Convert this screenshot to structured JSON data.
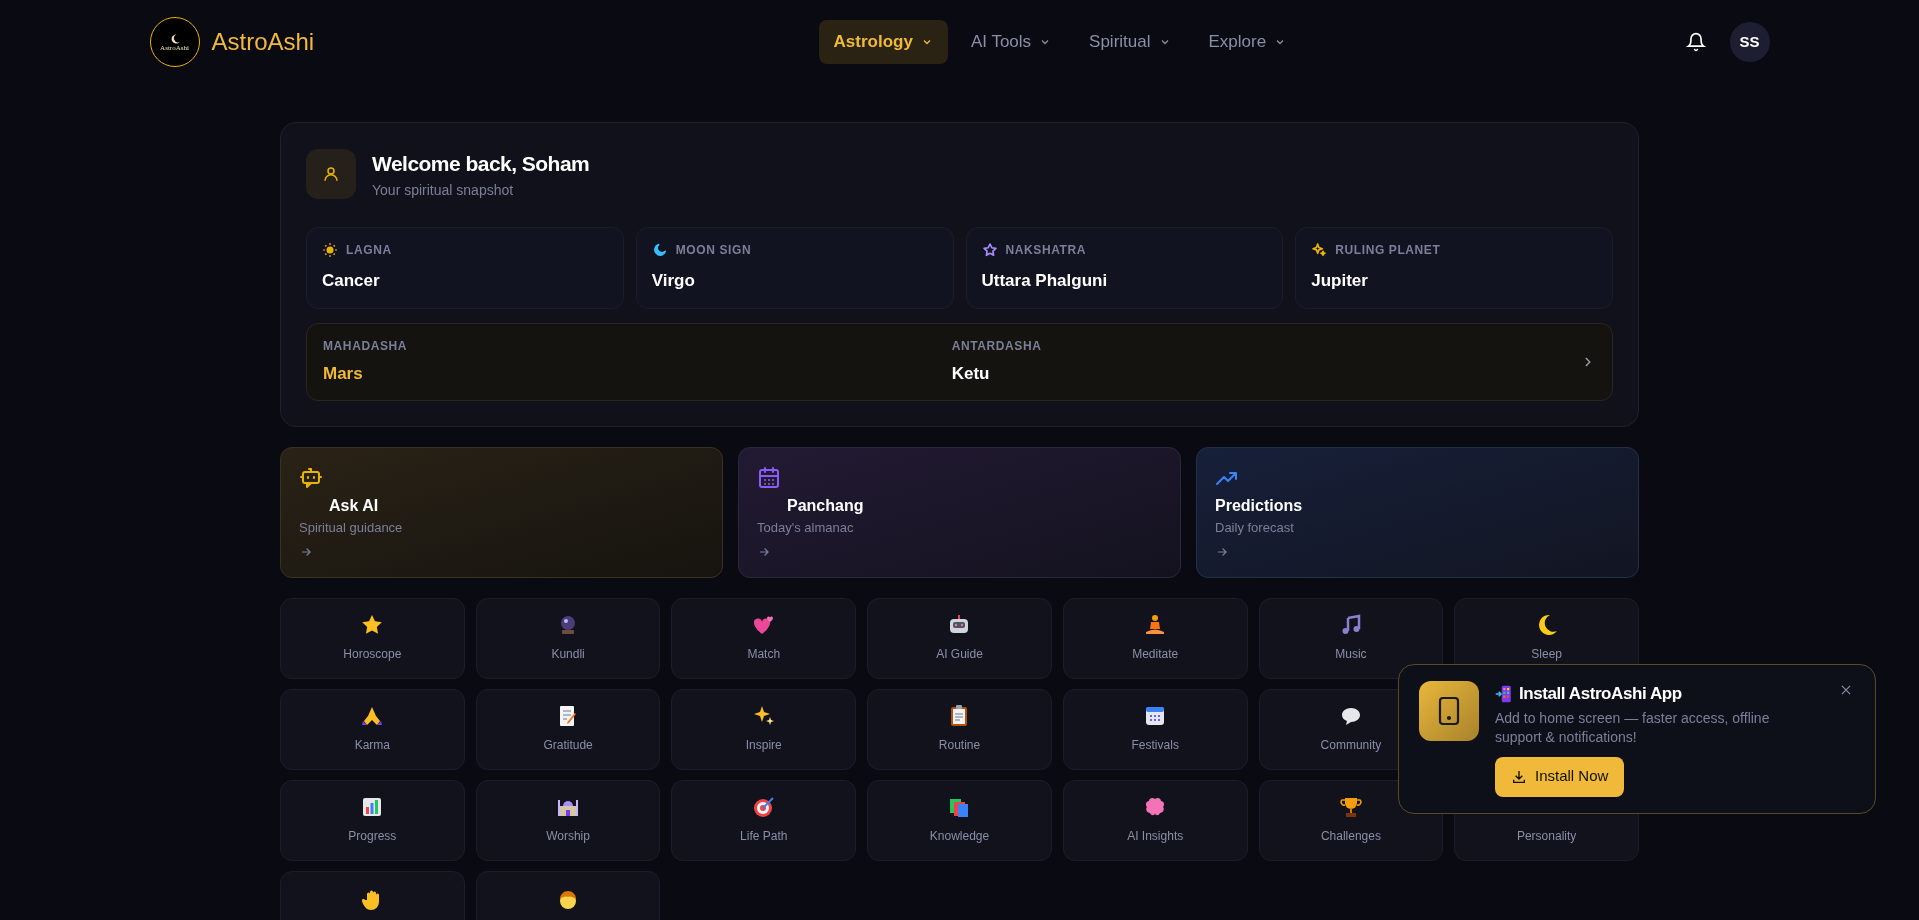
{
  "header": {
    "logo_text": "AstroAshi",
    "brand": "AstroAshi",
    "avatar": "SS",
    "nav": [
      {
        "label": "Astrology",
        "selected": true
      },
      {
        "label": "AI Tools",
        "selected": false
      },
      {
        "label": "Spiritual",
        "selected": false
      },
      {
        "label": "Explore",
        "selected": false
      }
    ]
  },
  "welcome": {
    "title": "Welcome back, Soham",
    "subtitle": "Your spiritual snapshot",
    "stats": [
      {
        "label": "LAGNA",
        "value": "Cancer",
        "color": "#eab308"
      },
      {
        "label": "MOON SIGN",
        "value": "Virgo",
        "color": "#38bdf8"
      },
      {
        "label": "NAKSHATRA",
        "value": "Uttara Phalguni",
        "color": "#a78bfa"
      },
      {
        "label": "RULING PLANET",
        "value": "Jupiter",
        "color": "#eab308"
      }
    ],
    "dasha": [
      {
        "label": "MAHADASHA",
        "value": "Mars",
        "kind": "highlight"
      },
      {
        "label": "ANTARDASHA",
        "value": "Ketu",
        "kind": "plain"
      }
    ]
  },
  "actions": [
    {
      "title": "Ask AI",
      "subtitle": "Spiritual guidance",
      "color": "#eab308"
    },
    {
      "title": "Panchang",
      "subtitle": "Today's almanac",
      "color": "#8b5cf6"
    },
    {
      "title": "Predictions",
      "subtitle": "Daily forecast",
      "color": "#3b82f6"
    }
  ],
  "tiles": [
    {
      "label": "Horoscope",
      "kind": "full"
    },
    {
      "label": "Kundli",
      "kind": "full"
    },
    {
      "label": "Match",
      "kind": "full"
    },
    {
      "label": "AI Guide",
      "kind": "full"
    },
    {
      "label": "Meditate",
      "kind": "full"
    },
    {
      "label": "Music",
      "kind": "full"
    },
    {
      "label": "Sleep",
      "kind": "full"
    },
    {
      "label": "Karma",
      "kind": "full"
    },
    {
      "label": "Gratitude",
      "kind": "full"
    },
    {
      "label": "Inspire",
      "kind": "full"
    },
    {
      "label": "Routine",
      "kind": "full"
    },
    {
      "label": "Festivals",
      "kind": "full"
    },
    {
      "label": "Community",
      "kind": "full"
    },
    {
      "label": "Progress",
      "kind": "full"
    },
    {
      "label": "Worship",
      "kind": "full"
    },
    {
      "label": "Life Path",
      "kind": "full"
    },
    {
      "label": "Knowledge",
      "kind": "full"
    },
    {
      "label": "AI Insights",
      "kind": "full"
    },
    {
      "label": "Challenges",
      "kind": "full"
    },
    {
      "label": "Personality",
      "kind": "label_only"
    },
    {
      "kind": "icon_only"
    },
    {
      "kind": "icon_only"
    }
  ],
  "install": {
    "title": "Install AstroAshi App",
    "text": "Add to home screen — faster access, offline support & notifications!",
    "button": "Install Now"
  }
}
